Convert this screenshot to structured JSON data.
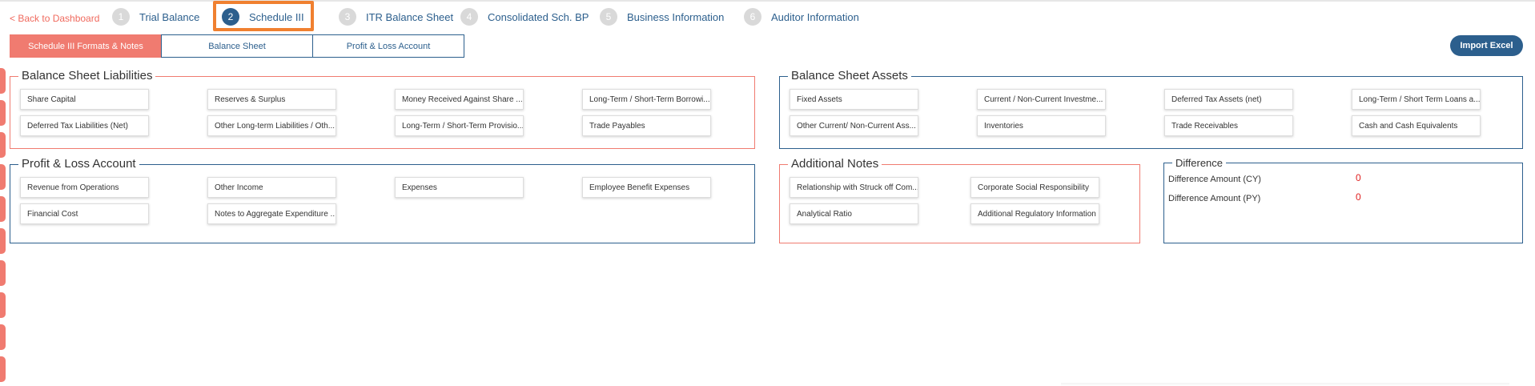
{
  "nav": {
    "back_label": "< Back to Dashboard"
  },
  "steps": [
    {
      "num": "1",
      "label": "Trial Balance"
    },
    {
      "num": "2",
      "label": "Schedule III"
    },
    {
      "num": "3",
      "label": "ITR Balance Sheet"
    },
    {
      "num": "4",
      "label": "Consolidated Sch. BP"
    },
    {
      "num": "5",
      "label": "Business Information"
    },
    {
      "num": "6",
      "label": "Auditor Information"
    }
  ],
  "tabs": [
    {
      "label": "Schedule III Formats & Notes"
    },
    {
      "label": "Balance Sheet"
    },
    {
      "label": "Profit & Loss Account"
    }
  ],
  "import_button": "Import Excel",
  "bs_liabilities": {
    "title": "Balance Sheet Liabilities",
    "items": [
      "Share Capital",
      "Reserves & Surplus",
      "Money Received Against Share ...",
      "Long-Term / Short-Term Borrowi...",
      "Deferred Tax Liabilities (Net)",
      "Other Long-term Liabilities / Oth...",
      "Long-Term / Short-Term Provisio...",
      "Trade Payables"
    ]
  },
  "bs_assets": {
    "title": "Balance Sheet Assets",
    "items": [
      "Fixed Assets",
      "Current / Non-Current Investme...",
      "Deferred Tax Assets (net)",
      "Long-Term / Short Term Loans a...",
      "Other Current/ Non-Current Ass...",
      "Inventories",
      "Trade Receivables",
      "Cash and Cash Equivalents"
    ]
  },
  "pl_account": {
    "title": "Profit & Loss Account",
    "items": [
      "Revenue from Operations",
      "Other Income",
      "Expenses",
      "Employee Benefit Expenses",
      "Financial Cost",
      "Notes to Aggregate Expenditure ..."
    ]
  },
  "additional_notes": {
    "title": "Additional Notes",
    "items": [
      "Relationship with Struck off Com...",
      "Corporate Social Responsibility",
      "Analytical Ratio",
      "Additional Regulatory Information"
    ]
  },
  "difference": {
    "title": "Difference",
    "cy_label": "Difference Amount (CY)",
    "cy_value": "0",
    "py_label": "Difference Amount (PY)",
    "py_value": "0"
  },
  "colors": {
    "primary": "#2c5f8d",
    "accent": "#f07b70",
    "highlight": "#f08030",
    "error": "#e02020"
  }
}
